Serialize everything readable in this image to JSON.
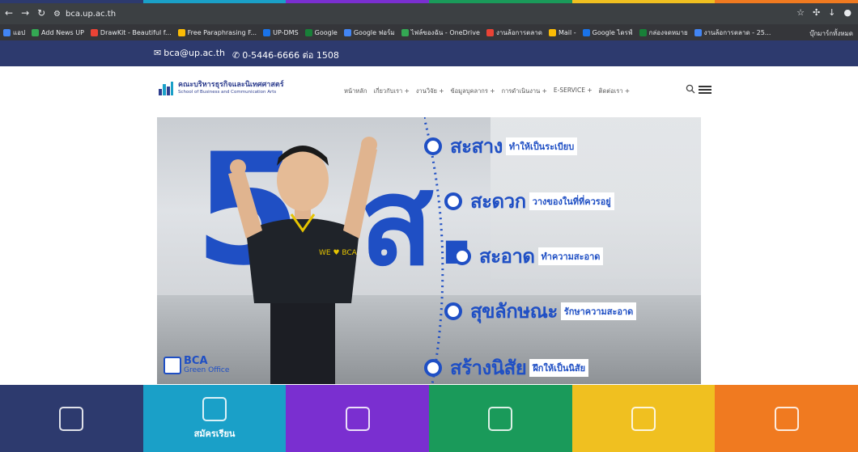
{
  "browser": {
    "url": "bca.up.ac.th",
    "strip_colors": [
      "#2d3a6e",
      "#1aa0c8",
      "#7a2fd0",
      "#1a9a5a",
      "#f0c020",
      "#f07a20"
    ],
    "bookmarks": [
      "แอป",
      "Add News UP",
      "DrawKit - Beautiful f...",
      "Free Paraphrasing F...",
      "UP-DMS",
      "Google",
      "Google ฟอร์ม",
      "ไฟล์ของฉัน - OneDrive",
      "งานล้อการตลาด",
      "Mail -",
      "Google ไดรฟ์",
      "กล่องจดหมาย",
      "งานล้อการตลาด - 25..."
    ],
    "bookmarks_right": "บุ๊กมาร์กทั้งหมด"
  },
  "contact": {
    "email": "bca@up.ac.th",
    "phone": "0-5446-6666 ต่อ 1508"
  },
  "header": {
    "logo_line1": "คณะบริหารธุรกิจและนิเทศศาสตร์",
    "logo_line2": "School of Business and Communication Arts",
    "nav": [
      "หน้าหลัก",
      "เกี่ยวกับเรา +",
      "งานวิจัย +",
      "ข้อมูลบุคลากร +",
      "การดำเนินงาน +",
      "E-SERVICE +",
      "ติดต่อเรา +"
    ]
  },
  "hero": {
    "big_number": "5",
    "big_letter": "ส.",
    "items": [
      {
        "title": "สะสาง",
        "note": "ทำให้เป็นระเบียบ"
      },
      {
        "title": "สะดวก",
        "note": "วางของในที่ที่ควรอยู่"
      },
      {
        "title": "สะอาด",
        "note": "ทำความสะอาด"
      },
      {
        "title": "สุขลักษณะ",
        "note": "รักษาความสะอาด"
      },
      {
        "title": "สร้างนิสัย",
        "note": "ฝึกให้เป็นนิสัย"
      }
    ],
    "badge_line1": "BCA",
    "badge_line2": "Green Office",
    "shirt_text": "WE ♥ BCA"
  },
  "tiles": [
    {
      "icon": "building-icon",
      "color": "#2d3a6e",
      "label": ""
    },
    {
      "icon": "graduation-cap-icon",
      "color": "#1aa0c8",
      "label": "สมัครเรียน"
    },
    {
      "icon": "globe-icon",
      "color": "#7a2fd0",
      "label": ""
    },
    {
      "icon": "vr-360-icon",
      "color": "#1a9a5a",
      "label": ""
    },
    {
      "icon": "certificate-icon",
      "color": "#f0c020",
      "label": ""
    },
    {
      "icon": "gear-icon",
      "color": "#f07a20",
      "label": ""
    }
  ]
}
